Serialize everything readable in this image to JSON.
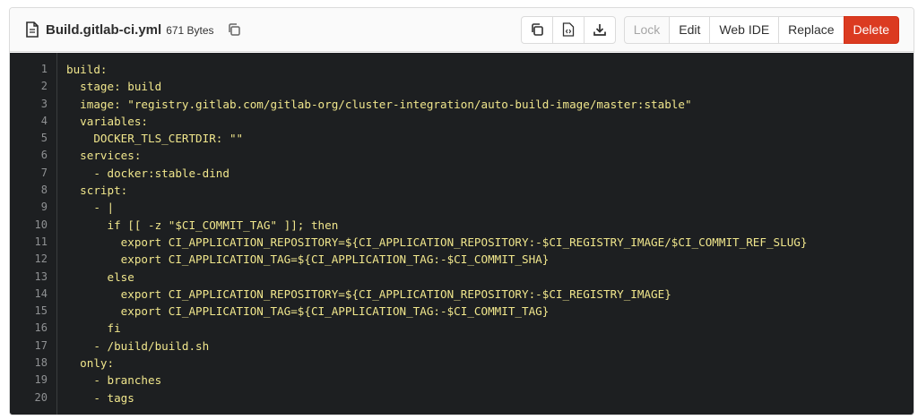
{
  "file": {
    "name": "Build.gitlab-ci.yml",
    "size": "671 Bytes"
  },
  "icons": {
    "file": "file-icon",
    "copy_path": "copy-icon",
    "copy_contents": "copy-icon",
    "raw": "file-code-icon",
    "download": "download-icon"
  },
  "actions": {
    "lock": "Lock",
    "edit": "Edit",
    "web_ide": "Web IDE",
    "replace": "Replace",
    "delete": "Delete"
  },
  "colors": {
    "code_bg": "#1d1f21",
    "code_text": "#f0e68c",
    "line_number": "#8f9193",
    "delete_bg": "#db3b21"
  },
  "code": {
    "line_numbers": [
      "1",
      "2",
      "3",
      "4",
      "5",
      "6",
      "7",
      "8",
      "9",
      "10",
      "11",
      "12",
      "13",
      "14",
      "15",
      "16",
      "17",
      "18",
      "19",
      "20"
    ],
    "lines": [
      "build:",
      "  stage: build",
      "  image: \"registry.gitlab.com/gitlab-org/cluster-integration/auto-build-image/master:stable\"",
      "  variables:",
      "    DOCKER_TLS_CERTDIR: \"\"",
      "  services:",
      "    - docker:stable-dind",
      "  script:",
      "    - |",
      "      if [[ -z \"$CI_COMMIT_TAG\" ]]; then",
      "        export CI_APPLICATION_REPOSITORY=${CI_APPLICATION_REPOSITORY:-$CI_REGISTRY_IMAGE/$CI_COMMIT_REF_SLUG}",
      "        export CI_APPLICATION_TAG=${CI_APPLICATION_TAG:-$CI_COMMIT_SHA}",
      "      else",
      "        export CI_APPLICATION_REPOSITORY=${CI_APPLICATION_REPOSITORY:-$CI_REGISTRY_IMAGE}",
      "        export CI_APPLICATION_TAG=${CI_APPLICATION_TAG:-$CI_COMMIT_TAG}",
      "      fi",
      "    - /build/build.sh",
      "  only:",
      "    - branches",
      "    - tags"
    ]
  }
}
